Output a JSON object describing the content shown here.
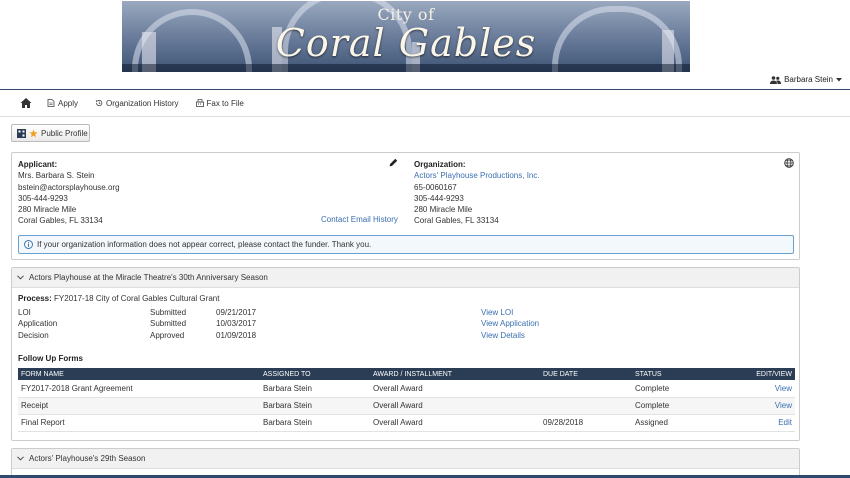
{
  "banner": {
    "city_of": "City of",
    "name": "Coral Gables"
  },
  "user": {
    "name": "Barbara Stein"
  },
  "nav": {
    "apply": "Apply",
    "org_history": "Organization History",
    "fax": "Fax to File"
  },
  "public_profile": "Public Profile",
  "applicant": {
    "heading": "Applicant:",
    "name": "Mrs. Barbara S. Stein",
    "email": "bstein@actorsplayhouse.org",
    "phone": "305-444-9293",
    "address1": "280 Miracle Mile",
    "address2": "Coral Gables, FL 33134",
    "contact_history": "Contact Email History"
  },
  "organization": {
    "heading": "Organization:",
    "name": "Actors' Playhouse Productions, Inc.",
    "ein": "65-0060167",
    "phone": "305-444-9293",
    "address1": "280 Miracle Mile",
    "address2": "Coral Gables, FL 33134"
  },
  "alert": "If your organization information does not appear correct, please contact the funder. Thank you.",
  "grant": {
    "title": "Actors Playhouse at the Miracle Theatre's 30th Anniversary Season",
    "process_label": "Process:",
    "process": "FY2017-18 City of Coral Gables Cultural Grant",
    "steps": [
      {
        "name": "LOI",
        "status": "Submitted",
        "date": "09/21/2017",
        "link": "View LOI"
      },
      {
        "name": "Application",
        "status": "Submitted",
        "date": "10/03/2017",
        "link": "View Application"
      },
      {
        "name": "Decision",
        "status": "Approved",
        "date": "01/09/2018",
        "link": "View Details"
      }
    ],
    "followup_title": "Follow Up Forms",
    "columns": [
      "FORM NAME",
      "ASSIGNED TO",
      "AWARD / INSTALLMENT",
      "DUE DATE",
      "STATUS",
      "EDIT/VIEW"
    ],
    "rows": [
      {
        "form": "FY2017-2018 Grant Agreement",
        "assigned": "Barbara Stein",
        "award": "Overall Award",
        "due": "",
        "status": "Complete",
        "action": "View"
      },
      {
        "form": "Receipt",
        "assigned": "Barbara Stein",
        "award": "Overall Award",
        "due": "",
        "status": "Complete",
        "action": "View"
      },
      {
        "form": "Final Report",
        "assigned": "Barbara Stein",
        "award": "Overall Award",
        "due": "09/28/2018",
        "status": "Assigned",
        "action": "Edit"
      }
    ]
  },
  "grant2": {
    "title": "Actors' Playhouse's 29th Season"
  },
  "colors": {
    "header_dark": "#2a3d55",
    "link": "#3a6fb0",
    "accent_rule": "#2f4a6e"
  }
}
